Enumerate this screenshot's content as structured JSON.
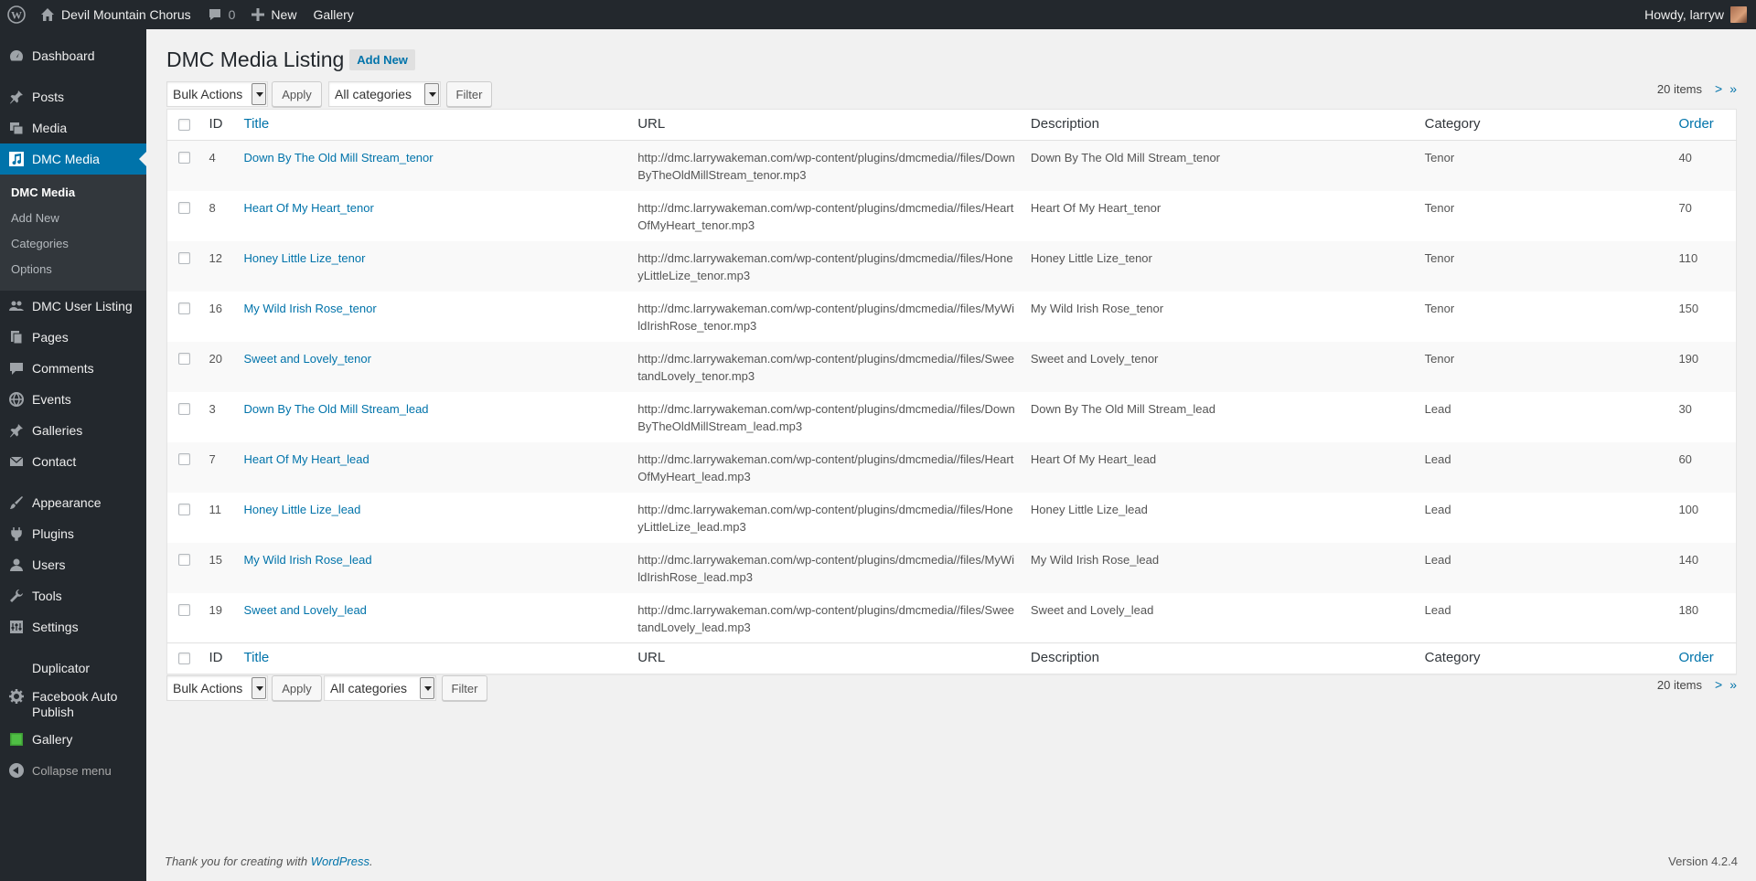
{
  "adminbar": {
    "site_name": "Devil Mountain Chorus",
    "comments_count": "0",
    "new_label": "New",
    "gallery_label": "Gallery",
    "howdy": "Howdy, larryw"
  },
  "sidebar": {
    "items": [
      {
        "label": "Dashboard",
        "icon": "dashboard-icon"
      },
      {
        "label": "Posts",
        "icon": "pin-icon"
      },
      {
        "label": "Media",
        "icon": "media-icon"
      },
      {
        "label": "DMC Media",
        "icon": "music-icon"
      },
      {
        "label": "DMC User Listing",
        "icon": "users-icon"
      },
      {
        "label": "Pages",
        "icon": "pages-icon"
      },
      {
        "label": "Comments",
        "icon": "comment-icon"
      },
      {
        "label": "Events",
        "icon": "globe-icon"
      },
      {
        "label": "Galleries",
        "icon": "pin-icon"
      },
      {
        "label": "Contact",
        "icon": "mail-icon"
      },
      {
        "label": "Appearance",
        "icon": "brush-icon"
      },
      {
        "label": "Plugins",
        "icon": "plugin-icon"
      },
      {
        "label": "Users",
        "icon": "user-icon"
      },
      {
        "label": "Tools",
        "icon": "wrench-icon"
      },
      {
        "label": "Settings",
        "icon": "settings-icon"
      },
      {
        "label": "Duplicator",
        "icon": "duplicator-icon"
      },
      {
        "label": "Facebook Auto Publish",
        "icon": "gear-icon"
      },
      {
        "label": "Gallery",
        "icon": "gallery-icon"
      }
    ],
    "submenu": [
      "DMC Media",
      "Add New",
      "Categories",
      "Options"
    ],
    "collapse_label": "Collapse menu"
  },
  "page": {
    "title": "DMC Media Listing",
    "add_new": "Add New"
  },
  "tablenav": {
    "bulk_actions": "Bulk Actions",
    "apply": "Apply",
    "category": "All categories",
    "filter": "Filter",
    "items_count": "20 items",
    "next": ">",
    "last": "»"
  },
  "table": {
    "columns": [
      "ID",
      "Title",
      "URL",
      "Description",
      "Category",
      "Order"
    ],
    "rows": [
      {
        "id": "4",
        "title": "Down By The Old Mill Stream_tenor",
        "url": "http://dmc.larrywakeman.com/wp-content/plugins/dmcmedia//files/DownByTheOldMillStream_tenor.mp3",
        "description": "Down By The Old Mill Stream_tenor",
        "category": "Tenor",
        "order": "40"
      },
      {
        "id": "8",
        "title": "Heart Of My Heart_tenor",
        "url": "http://dmc.larrywakeman.com/wp-content/plugins/dmcmedia//files/HeartOfMyHeart_tenor.mp3",
        "description": "Heart Of My Heart_tenor",
        "category": "Tenor",
        "order": "70"
      },
      {
        "id": "12",
        "title": "Honey Little Lize_tenor",
        "url": "http://dmc.larrywakeman.com/wp-content/plugins/dmcmedia//files/HoneyLittleLize_tenor.mp3",
        "description": "Honey Little Lize_tenor",
        "category": "Tenor",
        "order": "110"
      },
      {
        "id": "16",
        "title": "My Wild Irish Rose_tenor",
        "url": "http://dmc.larrywakeman.com/wp-content/plugins/dmcmedia//files/MyWildIrishRose_tenor.mp3",
        "description": "My Wild Irish Rose_tenor",
        "category": "Tenor",
        "order": "150"
      },
      {
        "id": "20",
        "title": "Sweet and Lovely_tenor",
        "url": "http://dmc.larrywakeman.com/wp-content/plugins/dmcmedia//files/SweetandLovely_tenor.mp3",
        "description": "Sweet and Lovely_tenor",
        "category": "Tenor",
        "order": "190"
      },
      {
        "id": "3",
        "title": "Down By The Old Mill Stream_lead",
        "url": "http://dmc.larrywakeman.com/wp-content/plugins/dmcmedia//files/DownByTheOldMillStream_lead.mp3",
        "description": "Down By The Old Mill Stream_lead",
        "category": "Lead",
        "order": "30"
      },
      {
        "id": "7",
        "title": "Heart Of My Heart_lead",
        "url": "http://dmc.larrywakeman.com/wp-content/plugins/dmcmedia//files/HeartOfMyHeart_lead.mp3",
        "description": "Heart Of My Heart_lead",
        "category": "Lead",
        "order": "60"
      },
      {
        "id": "11",
        "title": "Honey Little Lize_lead",
        "url": "http://dmc.larrywakeman.com/wp-content/plugins/dmcmedia//files/HoneyLittleLize_lead.mp3",
        "description": "Honey Little Lize_lead",
        "category": "Lead",
        "order": "100"
      },
      {
        "id": "15",
        "title": "My Wild Irish Rose_lead",
        "url": "http://dmc.larrywakeman.com/wp-content/plugins/dmcmedia//files/MyWildIrishRose_lead.mp3",
        "description": "My Wild Irish Rose_lead",
        "category": "Lead",
        "order": "140"
      },
      {
        "id": "19",
        "title": "Sweet and Lovely_lead",
        "url": "http://dmc.larrywakeman.com/wp-content/plugins/dmcmedia//files/SweetandLovely_lead.mp3",
        "description": "Sweet and Lovely_lead",
        "category": "Lead",
        "order": "180"
      }
    ]
  },
  "footer": {
    "thanks_prefix": "Thank you for creating with ",
    "thanks_link": "WordPress",
    "thanks_suffix": ".",
    "version": "Version 4.2.4"
  },
  "colors": {
    "adminbar_bg": "#23282d",
    "accent": "#0073aa",
    "page_bg": "#f1f1f1"
  }
}
